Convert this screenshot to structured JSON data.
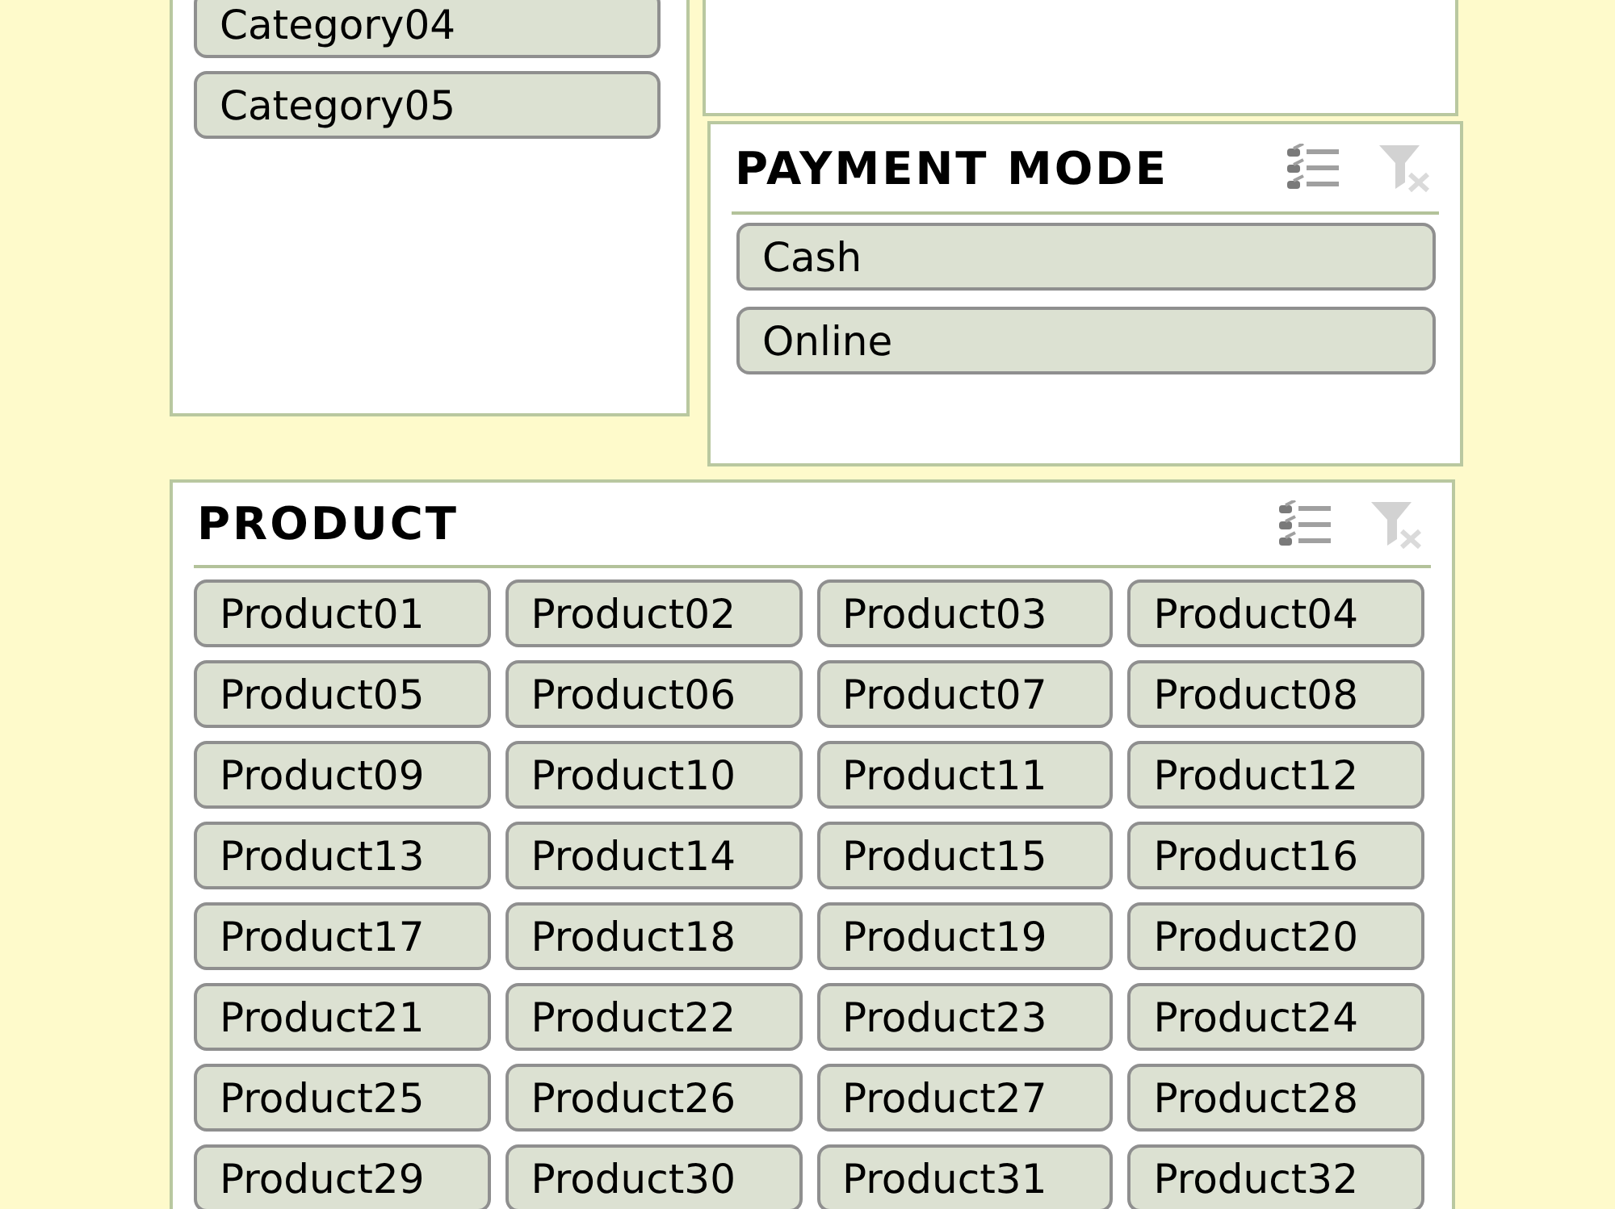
{
  "category_slicer": {
    "items": [
      {
        "label": "Category04",
        "selected": true
      },
      {
        "label": "Category05",
        "selected": true
      }
    ]
  },
  "payment_mode_slicer": {
    "title": "PAYMENT MODE",
    "multi_select": {
      "on": false
    },
    "clear_filter": {
      "disabled": true
    },
    "items": [
      {
        "label": "Cash",
        "selected": true
      },
      {
        "label": "Online",
        "selected": true
      }
    ]
  },
  "product_slicer": {
    "title": "PRODUCT",
    "multi_select": {
      "on": false
    },
    "clear_filter": {
      "disabled": true
    },
    "items": [
      {
        "label": "Product01",
        "selected": true
      },
      {
        "label": "Product02",
        "selected": true
      },
      {
        "label": "Product03",
        "selected": true
      },
      {
        "label": "Product04",
        "selected": true
      },
      {
        "label": "Product05",
        "selected": true
      },
      {
        "label": "Product06",
        "selected": true
      },
      {
        "label": "Product07",
        "selected": true
      },
      {
        "label": "Product08",
        "selected": true
      },
      {
        "label": "Product09",
        "selected": true
      },
      {
        "label": "Product10",
        "selected": true
      },
      {
        "label": "Product11",
        "selected": true
      },
      {
        "label": "Product12",
        "selected": true
      },
      {
        "label": "Product13",
        "selected": true
      },
      {
        "label": "Product14",
        "selected": true
      },
      {
        "label": "Product15",
        "selected": true
      },
      {
        "label": "Product16",
        "selected": true
      },
      {
        "label": "Product17",
        "selected": true
      },
      {
        "label": "Product18",
        "selected": true
      },
      {
        "label": "Product19",
        "selected": true
      },
      {
        "label": "Product20",
        "selected": true
      },
      {
        "label": "Product21",
        "selected": true
      },
      {
        "label": "Product22",
        "selected": true
      },
      {
        "label": "Product23",
        "selected": true
      },
      {
        "label": "Product24",
        "selected": true
      },
      {
        "label": "Product25",
        "selected": true
      },
      {
        "label": "Product26",
        "selected": true
      },
      {
        "label": "Product27",
        "selected": true
      },
      {
        "label": "Product28",
        "selected": true
      },
      {
        "label": "Product29",
        "selected": true
      },
      {
        "label": "Product30",
        "selected": true
      },
      {
        "label": "Product31",
        "selected": true
      },
      {
        "label": "Product32",
        "selected": true
      }
    ]
  }
}
